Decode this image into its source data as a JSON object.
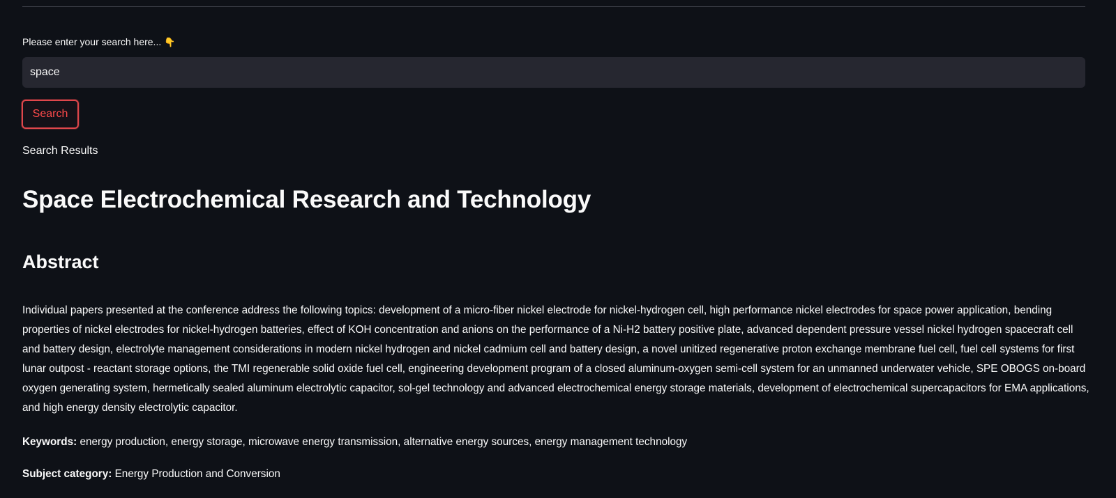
{
  "search": {
    "label": "Please enter your search here...",
    "label_emoji": "👇",
    "value": "space",
    "button_label": "Search"
  },
  "results": {
    "heading": "Search Results",
    "title": "Space Electrochemical Research and Technology",
    "abstract_heading": "Abstract",
    "abstract_text": "Individual papers presented at the conference address the following topics: development of a micro-fiber nickel electrode for nickel-hydrogen cell, high performance nickel electrodes for space power application, bending properties of nickel electrodes for nickel-hydrogen batteries, effect of KOH concentration and anions on the performance of a Ni-H2 battery positive plate, advanced dependent pressure vessel nickel hydrogen spacecraft cell and battery design, electrolyte management considerations in modern nickel hydrogen and nickel cadmium cell and battery design, a novel unitized regenerative proton exchange membrane fuel cell, fuel cell systems for first lunar outpost - reactant storage options, the TMI regenerable solid oxide fuel cell, engineering development program of a closed aluminum-oxygen semi-cell system for an unmanned underwater vehicle, SPE OBOGS on-board oxygen generating system, hermetically sealed aluminum electrolytic capacitor, sol-gel technology and advanced electrochemical energy storage materials, development of electrochemical supercapacitors for EMA applications, and high energy density electrolytic capacitor.",
    "keywords_label": "Keywords:",
    "keywords": "energy production, energy storage, microwave energy transmission, alternative energy sources, energy management technology",
    "subject_label": "Subject category:",
    "subject": "Energy Production and Conversion"
  },
  "colors": {
    "background": "#0e1117",
    "input_background": "#262730",
    "accent": "#ff4b4b",
    "text": "#fafafa"
  }
}
